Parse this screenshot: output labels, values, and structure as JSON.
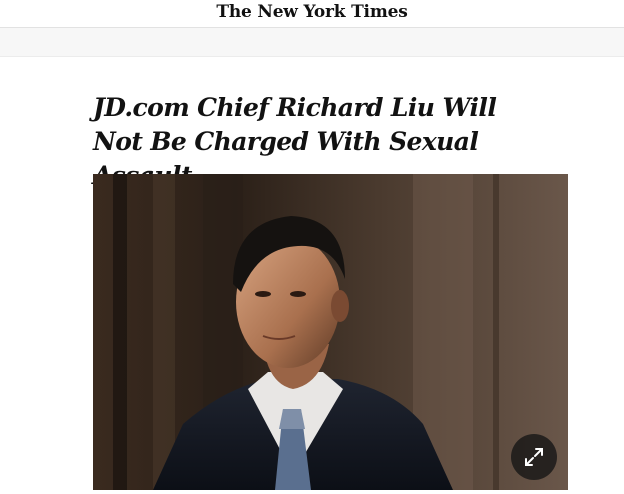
{
  "masthead": {
    "logo_text": "The New York Times"
  },
  "article": {
    "headline": "JD.com Chief Richard Liu Will Not Be Charged With Sexual Assault"
  },
  "media": {
    "expand_icon": "expand-arrows-icon"
  }
}
